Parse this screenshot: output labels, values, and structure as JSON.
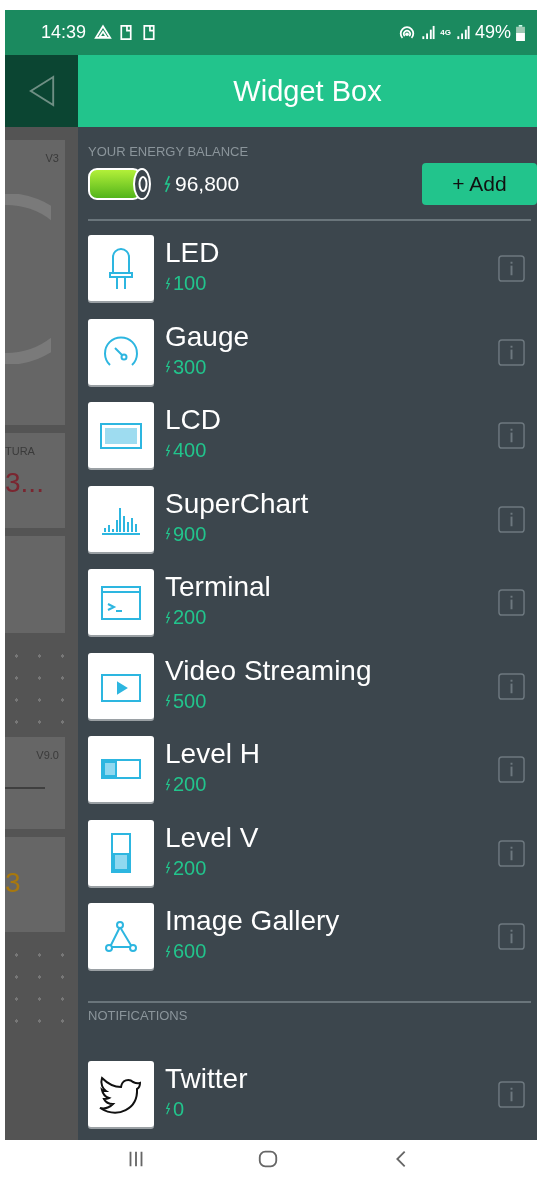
{
  "status_bar": {
    "time": "14:39",
    "network_type": "4G",
    "battery": "49%"
  },
  "header": {
    "title": "Widget Box"
  },
  "background_dashboard": [
    {
      "kind": "gauge",
      "label": "V3"
    },
    {
      "kind": "value",
      "label": "TURA",
      "value": "3...",
      "color": "#7a2630"
    },
    {
      "kind": "blank"
    },
    {
      "kind": "grid"
    },
    {
      "kind": "slider",
      "label": "V9.0"
    },
    {
      "kind": "value",
      "value": "3",
      "color": "#a8780e"
    },
    {
      "kind": "grid"
    }
  ],
  "energy": {
    "label": "YOUR ENERGY BALANCE",
    "balance": "96,800",
    "add_button": "+ Add"
  },
  "widgets": [
    {
      "kind": "led",
      "name": "LED",
      "price": "100"
    },
    {
      "kind": "gauge",
      "name": "Gauge",
      "price": "300"
    },
    {
      "kind": "lcd",
      "name": "LCD",
      "price": "400"
    },
    {
      "kind": "chart",
      "name": "SuperChart",
      "price": "900"
    },
    {
      "kind": "terminal",
      "name": "Terminal",
      "price": "200"
    },
    {
      "kind": "video",
      "name": "Video Streaming",
      "price": "500"
    },
    {
      "kind": "level_h",
      "name": "Level H",
      "price": "200"
    },
    {
      "kind": "level_v",
      "name": "Level V",
      "price": "200"
    },
    {
      "kind": "gallery",
      "name": "Image Gallery",
      "price": "600"
    }
  ],
  "notifications": {
    "title": "NOTIFICATIONS",
    "widgets": [
      {
        "kind": "twitter",
        "name": "Twitter",
        "price": "0"
      }
    ]
  }
}
